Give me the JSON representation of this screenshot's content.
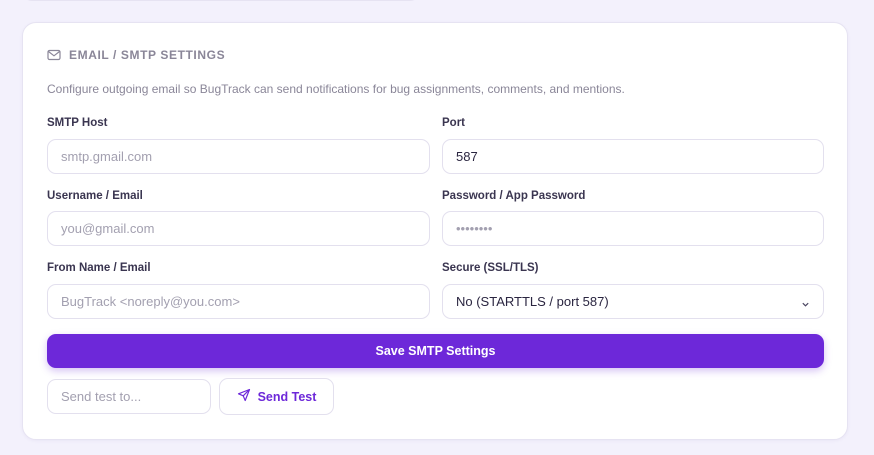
{
  "section": {
    "title": "EMAIL / SMTP SETTINGS",
    "icon": "mail-icon",
    "description": "Configure outgoing email so BugTrack can send notifications for bug assignments, comments, and mentions."
  },
  "fields": {
    "smtp_host": {
      "label": "SMTP Host",
      "value": "",
      "placeholder": "smtp.gmail.com"
    },
    "port": {
      "label": "Port",
      "value": "587",
      "placeholder": ""
    },
    "username": {
      "label": "Username / Email",
      "value": "",
      "placeholder": "you@gmail.com"
    },
    "password": {
      "label": "Password / App Password",
      "value": "",
      "placeholder": "••••••••"
    },
    "from": {
      "label": "From Name / Email",
      "value": "",
      "placeholder": "BugTrack <noreply@you.com>"
    },
    "secure": {
      "label": "Secure (SSL/TLS)",
      "selected": "No (STARTTLS / port 587)"
    }
  },
  "actions": {
    "save_label": "Save SMTP Settings",
    "test_placeholder": "Send test to...",
    "test_label": "Send Test",
    "test_icon": "send-icon"
  },
  "colors": {
    "accent": "#6d28d9",
    "background": "#f3f1fc"
  }
}
